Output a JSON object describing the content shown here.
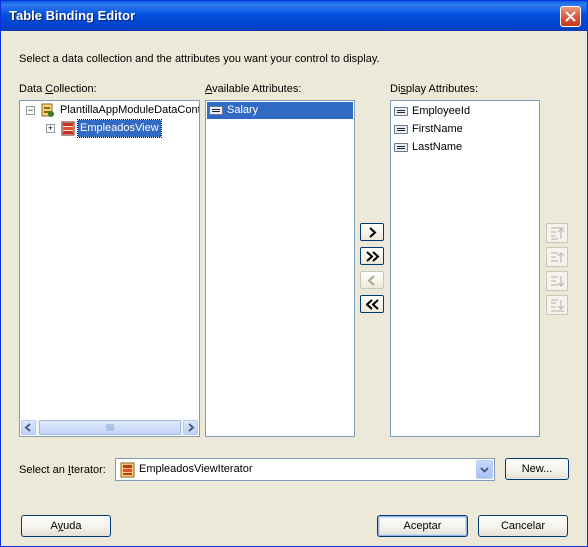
{
  "window": {
    "title": "Table Binding Editor"
  },
  "description": "Select a data collection and the attributes you want your control to display.",
  "data_collection": {
    "label_pre": "Data ",
    "label_ul": "C",
    "label_post": "ollection:",
    "root": "PlantillaAppModuleDataControl",
    "child": "EmpleadosView"
  },
  "available": {
    "label_pre": "",
    "label_ul": "A",
    "label_post": "vailable Attributes:",
    "items": [
      "Salary"
    ]
  },
  "display": {
    "label_pre": "Di",
    "label_ul": "s",
    "label_post": "play Attributes:",
    "items": [
      "EmployeeId",
      "FirstName",
      "LastName"
    ]
  },
  "iterator": {
    "label_pre": "Select an ",
    "label_ul": "I",
    "label_post": "terator:",
    "value": "EmpleadosViewIterator",
    "new_label": "New..."
  },
  "buttons": {
    "help_pre": "A",
    "help_ul": "y",
    "help_post": "uda",
    "ok": "Aceptar",
    "cancel": "Cancelar"
  },
  "icons": {
    "move_right": "chevron-right-icon",
    "move_all_right": "double-chevron-right-icon",
    "move_left": "chevron-left-icon",
    "move_all_left": "double-chevron-left-icon",
    "move_top": "move-top-icon",
    "move_up": "move-up-icon",
    "move_down": "move-down-icon",
    "move_bottom": "move-bottom-icon"
  },
  "colors": {
    "selection": "#316ac5",
    "titlebar": "#0551e0",
    "dialog_bg": "#ece9d8"
  }
}
